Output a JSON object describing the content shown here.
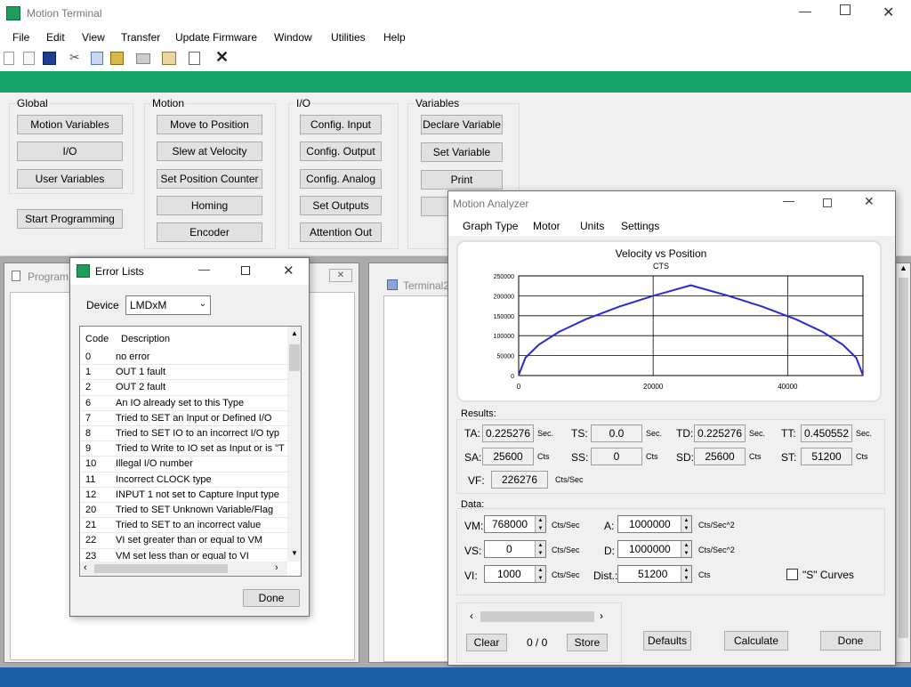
{
  "app": {
    "title": "Motion Terminal"
  },
  "menu": [
    "File",
    "Edit",
    "View",
    "Transfer",
    "Update Firmware",
    "Window",
    "Utilities",
    "Help"
  ],
  "groups": {
    "global": {
      "label": "Global",
      "buttons": [
        "Motion Variables",
        "I/O",
        "User Variables"
      ],
      "start": "Start Programming"
    },
    "motion": {
      "label": "Motion",
      "buttons": [
        "Move to Position",
        "Slew at Velocity",
        "Set Position Counter",
        "Homing",
        "Encoder"
      ]
    },
    "io": {
      "label": "I/O",
      "buttons": [
        "Config. Input",
        "Config. Output",
        "Config. Analog",
        "Set Outputs",
        "Attention Out"
      ]
    },
    "variables": {
      "label": "Variables",
      "buttons": [
        "Declare Variable",
        "Set Variable",
        "Print"
      ]
    }
  },
  "bg_windows": {
    "program": "Program",
    "terminal": "Terminal2"
  },
  "error_lists": {
    "title": "Error Lists",
    "device_label": "Device",
    "device_value": "LMDxM",
    "col_code": "Code",
    "col_desc": "Description",
    "rows": [
      {
        "code": "0",
        "desc": "no error"
      },
      {
        "code": "1",
        "desc": "OUT 1 fault"
      },
      {
        "code": "2",
        "desc": "OUT 2 fault"
      },
      {
        "code": "6",
        "desc": "An IO already set to this Type"
      },
      {
        "code": "7",
        "desc": "Tried to SET an Input or Defined I/O"
      },
      {
        "code": "8",
        "desc": "Tried to SET IO to an incorrect I/O typ"
      },
      {
        "code": "9",
        "desc": "Tried to Write to IO set as Input or is \"T"
      },
      {
        "code": "10",
        "desc": "Illegal I/O number"
      },
      {
        "code": "11",
        "desc": "Incorrect CLOCK type"
      },
      {
        "code": "12",
        "desc": "INPUT 1 not set to Capture Input type"
      },
      {
        "code": "20",
        "desc": "Tried to SET Unknown Variable/Flag"
      },
      {
        "code": "21",
        "desc": "Tried to SET to an incorrect value"
      },
      {
        "code": "22",
        "desc": "VI set greater than or equal to VM"
      },
      {
        "code": "23",
        "desc": "VM set less than or equal to VI"
      }
    ],
    "done": "Done"
  },
  "analyzer": {
    "title": "Motion Analyzer",
    "menu": [
      "Graph Type",
      "Motor",
      "Units",
      "Settings"
    ],
    "results_label": "Results:",
    "results": {
      "TA": {
        "label": "TA:",
        "value": "0.225276",
        "unit": "Sec."
      },
      "TS": {
        "label": "TS:",
        "value": "0.0",
        "unit": "Sec."
      },
      "TD": {
        "label": "TD:",
        "value": "0.225276",
        "unit": "Sec."
      },
      "TT": {
        "label": "TT:",
        "value": "0.450552",
        "unit": "Sec."
      },
      "SA": {
        "label": "SA:",
        "value": "25600",
        "unit": "Cts"
      },
      "SS": {
        "label": "SS:",
        "value": "0",
        "unit": "Cts"
      },
      "SD": {
        "label": "SD:",
        "value": "25600",
        "unit": "Cts"
      },
      "ST": {
        "label": "ST:",
        "value": "51200",
        "unit": "Cts"
      },
      "VF": {
        "label": "VF:",
        "value": "226276",
        "unit": "Cts/Sec"
      }
    },
    "data_label": "Data:",
    "data": {
      "VM": {
        "label": "VM:",
        "value": "768000",
        "unit": "Cts/Sec"
      },
      "A": {
        "label": "A:",
        "value": "1000000",
        "unit": "Cts/Sec^2"
      },
      "VS": {
        "label": "VS:",
        "value": "0",
        "unit": "Cts/Sec"
      },
      "D": {
        "label": "D:",
        "value": "1000000",
        "unit": "Cts/Sec^2"
      },
      "VI": {
        "label": "VI:",
        "value": "1000",
        "unit": "Cts/Sec"
      },
      "Dist": {
        "label": "Dist.:",
        "value": "51200",
        "unit": "Cts"
      }
    },
    "s_curves": "\"S\" Curves",
    "clear": "Clear",
    "counter": "0 / 0",
    "store": "Store",
    "defaults": "Defaults",
    "calculate": "Calculate",
    "done": "Done"
  },
  "chart_data": {
    "type": "line",
    "title": "Velocity vs Position",
    "subtitle": "CTS",
    "xlabel": "",
    "ylabel": "",
    "xlim": [
      0,
      51200
    ],
    "ylim": [
      0,
      250000
    ],
    "xticks": [
      0,
      20000,
      40000
    ],
    "yticks": [
      0,
      50000,
      100000,
      150000,
      200000,
      250000
    ],
    "grid": true,
    "color": "#2a2ad0",
    "x": [
      0,
      1000,
      3000,
      6000,
      10000,
      15000,
      20000,
      25600,
      31200,
      36200,
      41200,
      45200,
      48200,
      50200,
      51200
    ],
    "y": [
      1000,
      44700,
      77500,
      109500,
      141400,
      173200,
      200000,
      226276,
      200000,
      173200,
      141400,
      109500,
      77500,
      44700,
      1000
    ]
  }
}
